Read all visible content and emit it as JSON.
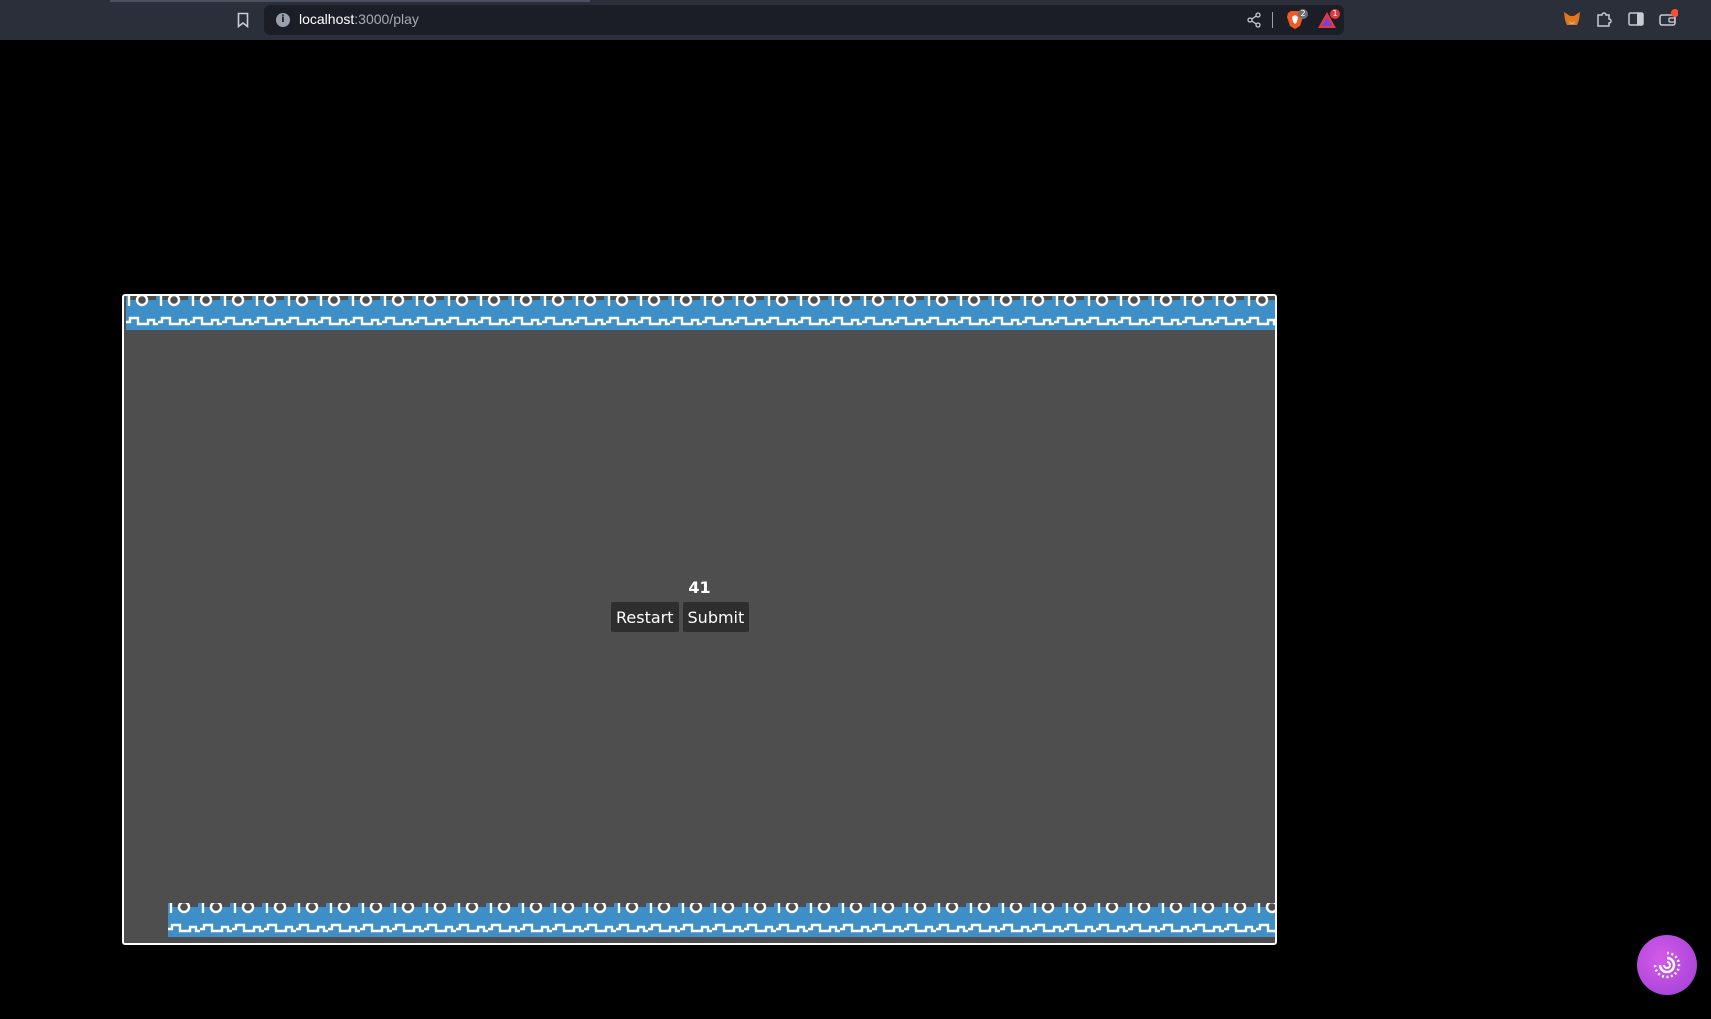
{
  "browser": {
    "url_host": "localhost",
    "url_path": ":3000/play",
    "brave_shields_count": "2",
    "rewards_count": "1",
    "icons": [
      "bookmark-icon",
      "site-info-icon",
      "share-icon",
      "brave-shields-icon",
      "brave-rewards-icon",
      "metamask-fox-icon",
      "extensions-puzzle-icon",
      "sidebar-toggle-icon",
      "wallet-icon"
    ]
  },
  "game": {
    "score": "41",
    "restart_label": "Restart",
    "submit_label": "Submit",
    "background_color": "#4e4e4e",
    "border_color": "#3e8ec8"
  },
  "assistant": {
    "icon": "assistant-swirl-icon",
    "color": "#c44ee0"
  }
}
